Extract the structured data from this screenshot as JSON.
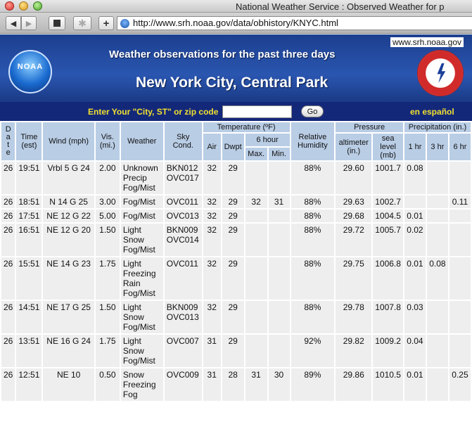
{
  "window": {
    "title": "National Weather Service : Observed Weather for p",
    "url": "http://www.srh.noaa.gov/data/obhistory/KNYC.html"
  },
  "toolbar": {
    "back_icon": "◀",
    "forward_icon": "▶",
    "gear_icon": "✱",
    "plus_icon": "+"
  },
  "banner": {
    "site_url": "www.srh.noaa.gov",
    "noaa_logo_text": "NOAA",
    "title": "Weather observations for the past three days",
    "city": "New York City, Central Park"
  },
  "search": {
    "label": "Enter Your \"City, ST\" or zip code",
    "value": "",
    "go_label": "Go",
    "espanol": "en español"
  },
  "table": {
    "headers": {
      "date": "D\na\nt\ne",
      "time": "Time (est)",
      "wind": "Wind (mph)",
      "vis": "Vis. (mi.)",
      "weather": "Weather",
      "sky": "Sky Cond.",
      "temperature": "Temperature (ºF)",
      "air": "Air",
      "dwpt": "Dwpt",
      "six_hour": "6 hour",
      "max": "Max.",
      "min": "Min.",
      "humidity": "Relative Humidity",
      "pressure": "Pressure",
      "altimeter": "altimeter (in.)",
      "sea_level": "sea level (mb)",
      "precipitation": "Precipitation (in.)",
      "p1": "1 hr",
      "p3": "3 hr",
      "p6": "6 hr"
    },
    "rows": [
      {
        "date": "26",
        "time": "19:51",
        "wind": "Vrbl 5 G 24",
        "vis": "2.00",
        "weather": "Unknown Precip Fog/Mist",
        "sky": "BKN012 OVC017",
        "air": "32",
        "dwpt": "29",
        "max": "",
        "min": "",
        "rh": "88%",
        "alt": "29.60",
        "slp": "1001.7",
        "p1": "0.08",
        "p3": "",
        "p6": ""
      },
      {
        "date": "26",
        "time": "18:51",
        "wind": "N 14 G 25",
        "vis": "3.00",
        "weather": "Fog/Mist",
        "sky": "OVC011",
        "air": "32",
        "dwpt": "29",
        "max": "32",
        "min": "31",
        "rh": "88%",
        "alt": "29.63",
        "slp": "1002.7",
        "p1": "",
        "p3": "",
        "p6": "0.11"
      },
      {
        "date": "26",
        "time": "17:51",
        "wind": "NE 12 G 22",
        "vis": "5.00",
        "weather": "Fog/Mist",
        "sky": "OVC013",
        "air": "32",
        "dwpt": "29",
        "max": "",
        "min": "",
        "rh": "88%",
        "alt": "29.68",
        "slp": "1004.5",
        "p1": "0.01",
        "p3": "",
        "p6": ""
      },
      {
        "date": "26",
        "time": "16:51",
        "wind": "NE 12 G 20",
        "vis": "1.50",
        "weather": "Light Snow Fog/Mist",
        "sky": "BKN009 OVC014",
        "air": "32",
        "dwpt": "29",
        "max": "",
        "min": "",
        "rh": "88%",
        "alt": "29.72",
        "slp": "1005.7",
        "p1": "0.02",
        "p3": "",
        "p6": ""
      },
      {
        "date": "26",
        "time": "15:51",
        "wind": "NE 14 G 23",
        "vis": "1.75",
        "weather": "Light Freezing Rain Fog/Mist",
        "sky": "OVC011",
        "air": "32",
        "dwpt": "29",
        "max": "",
        "min": "",
        "rh": "88%",
        "alt": "29.75",
        "slp": "1006.8",
        "p1": "0.01",
        "p3": "0.08",
        "p6": ""
      },
      {
        "date": "26",
        "time": "14:51",
        "wind": "NE 17 G 25",
        "vis": "1.50",
        "weather": "Light Snow Fog/Mist",
        "sky": "BKN009 OVC013",
        "air": "32",
        "dwpt": "29",
        "max": "",
        "min": "",
        "rh": "88%",
        "alt": "29.78",
        "slp": "1007.8",
        "p1": "0.03",
        "p3": "",
        "p6": ""
      },
      {
        "date": "26",
        "time": "13:51",
        "wind": "NE 16 G 24",
        "vis": "1.75",
        "weather": "Light Snow Fog/Mist",
        "sky": "OVC007",
        "air": "31",
        "dwpt": "29",
        "max": "",
        "min": "",
        "rh": "92%",
        "alt": "29.82",
        "slp": "1009.2",
        "p1": "0.04",
        "p3": "",
        "p6": ""
      },
      {
        "date": "26",
        "time": "12:51",
        "wind": "NE 10",
        "vis": "0.50",
        "weather": "Snow Freezing Fog",
        "sky": "OVC009",
        "air": "31",
        "dwpt": "28",
        "max": "31",
        "min": "30",
        "rh": "89%",
        "alt": "29.86",
        "slp": "1010.5",
        "p1": "0.01",
        "p3": "",
        "p6": "0.25"
      }
    ]
  }
}
